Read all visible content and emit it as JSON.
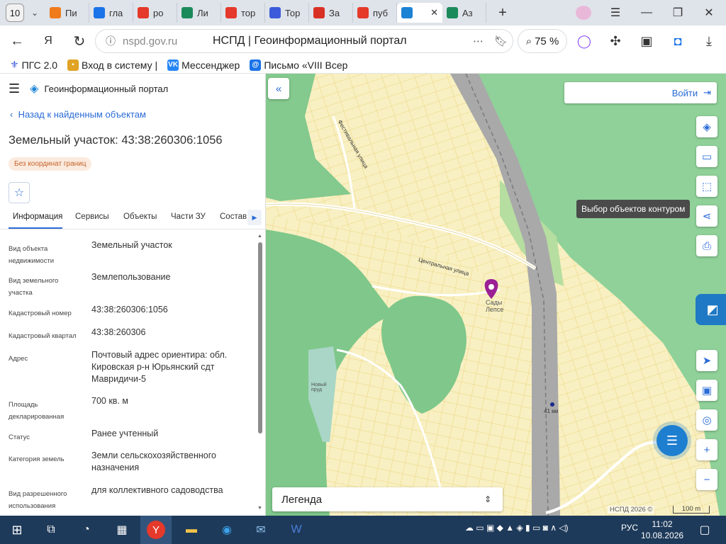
{
  "browser": {
    "tab_count": "10",
    "tabs": [
      {
        "label": "Пи",
        "icon": "mail-icon",
        "color": "#f07b1d"
      },
      {
        "label": "гла",
        "icon": "document-icon",
        "color": "#1a73e8"
      },
      {
        "label": "ро",
        "icon": "yandex-icon",
        "color": "#e5392b"
      },
      {
        "label": "Ли",
        "icon": "emblem-icon",
        "color": "#1b8a5a"
      },
      {
        "label": "тор",
        "icon": "yandex-icon",
        "color": "#e5392b"
      },
      {
        "label": "Тор",
        "icon": "flower-icon",
        "color": "#3b5bdb"
      },
      {
        "label": "За",
        "icon": "stop-icon",
        "color": "#d93025"
      },
      {
        "label": "пуб",
        "icon": "yandex-icon",
        "color": "#e5392b"
      },
      {
        "label": "",
        "icon": "nspd-icon",
        "color": "#1c82d4",
        "active": true
      },
      {
        "label": "Аз",
        "icon": "emblem-icon",
        "color": "#1b8a5a"
      }
    ],
    "url": "nspd.gov.ru",
    "page_title": "НСПД | Геоинформационный портал",
    "zoom": "75 %",
    "bookmarks": [
      "ПГС 2.0",
      "Вход в систему | ",
      "Мессенджер",
      "Письмо «VIII Всер"
    ]
  },
  "panel": {
    "app_title": "Геоинформационный портал",
    "back_link": "Назад к найденным объектам",
    "object_title": "Земельный участок: 43:38:260306:1056",
    "badge": "Без координат границ",
    "tabs": [
      "Информация",
      "Сервисы",
      "Объекты",
      "Части ЗУ",
      "Состав"
    ],
    "rows": [
      {
        "label": "Вид объекта недвижимости",
        "value": "Земельный участок"
      },
      {
        "label": "Вид земельного участка",
        "value": "Землепользование"
      },
      {
        "label": "Кадастровый номер",
        "value": "43:38:260306:1056"
      },
      {
        "label": "Кадастровый квартал",
        "value": "43:38:260306"
      },
      {
        "label": "Адрес",
        "value": "Почтовый адрес ориентира: обл. Кировская р-н Юрьянский сдт Мавридичи-5"
      },
      {
        "label": "Площадь декларированная",
        "value": "700 кв. м"
      },
      {
        "label": "Статус",
        "value": "Ранее учтенный"
      },
      {
        "label": "Категория земель",
        "value": "Земли сельскохозяйственного назначения"
      },
      {
        "label": "Вид разрешенного использования",
        "value": "для коллективного садоводства"
      }
    ]
  },
  "map": {
    "login": "Войти",
    "tooltip": "Выбор объектов контуром",
    "legend": "Легенда",
    "copyright": "НСПД 2026 ©",
    "scale": "100 m",
    "labels": {
      "street1": "Центральная улица",
      "street2": "Фестивальная улица",
      "place": "Сады Лепсе",
      "pond": "Новый пруд",
      "km": "41 км"
    }
  },
  "taskbar": {
    "lang": "РУС",
    "time": "11:02",
    "date": "10.08.2026"
  }
}
